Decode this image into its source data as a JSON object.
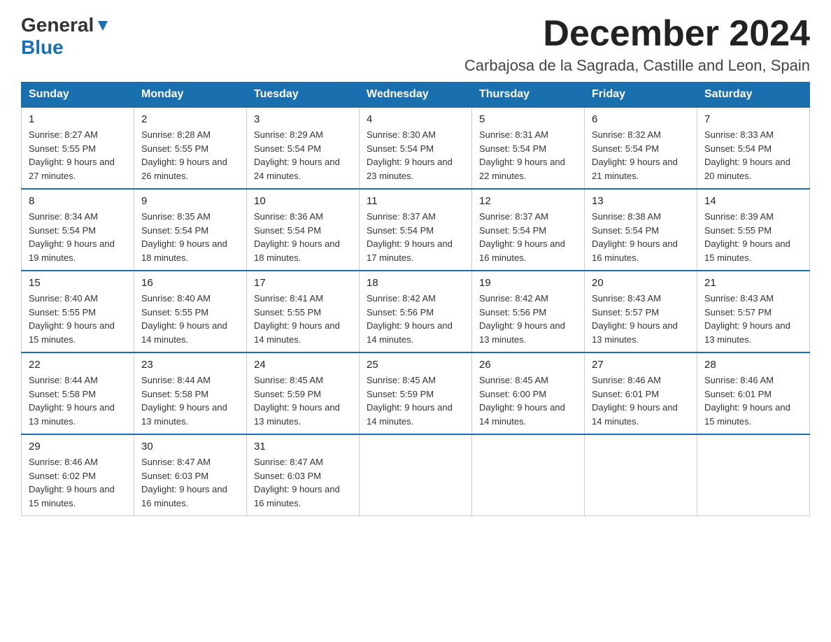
{
  "logo": {
    "general": "General",
    "blue": "Blue"
  },
  "title": "December 2024",
  "subtitle": "Carbajosa de la Sagrada, Castille and Leon, Spain",
  "days_of_week": [
    "Sunday",
    "Monday",
    "Tuesday",
    "Wednesday",
    "Thursday",
    "Friday",
    "Saturday"
  ],
  "weeks": [
    [
      {
        "day": "1",
        "sunrise": "Sunrise: 8:27 AM",
        "sunset": "Sunset: 5:55 PM",
        "daylight": "Daylight: 9 hours and 27 minutes."
      },
      {
        "day": "2",
        "sunrise": "Sunrise: 8:28 AM",
        "sunset": "Sunset: 5:55 PM",
        "daylight": "Daylight: 9 hours and 26 minutes."
      },
      {
        "day": "3",
        "sunrise": "Sunrise: 8:29 AM",
        "sunset": "Sunset: 5:54 PM",
        "daylight": "Daylight: 9 hours and 24 minutes."
      },
      {
        "day": "4",
        "sunrise": "Sunrise: 8:30 AM",
        "sunset": "Sunset: 5:54 PM",
        "daylight": "Daylight: 9 hours and 23 minutes."
      },
      {
        "day": "5",
        "sunrise": "Sunrise: 8:31 AM",
        "sunset": "Sunset: 5:54 PM",
        "daylight": "Daylight: 9 hours and 22 minutes."
      },
      {
        "day": "6",
        "sunrise": "Sunrise: 8:32 AM",
        "sunset": "Sunset: 5:54 PM",
        "daylight": "Daylight: 9 hours and 21 minutes."
      },
      {
        "day": "7",
        "sunrise": "Sunrise: 8:33 AM",
        "sunset": "Sunset: 5:54 PM",
        "daylight": "Daylight: 9 hours and 20 minutes."
      }
    ],
    [
      {
        "day": "8",
        "sunrise": "Sunrise: 8:34 AM",
        "sunset": "Sunset: 5:54 PM",
        "daylight": "Daylight: 9 hours and 19 minutes."
      },
      {
        "day": "9",
        "sunrise": "Sunrise: 8:35 AM",
        "sunset": "Sunset: 5:54 PM",
        "daylight": "Daylight: 9 hours and 18 minutes."
      },
      {
        "day": "10",
        "sunrise": "Sunrise: 8:36 AM",
        "sunset": "Sunset: 5:54 PM",
        "daylight": "Daylight: 9 hours and 18 minutes."
      },
      {
        "day": "11",
        "sunrise": "Sunrise: 8:37 AM",
        "sunset": "Sunset: 5:54 PM",
        "daylight": "Daylight: 9 hours and 17 minutes."
      },
      {
        "day": "12",
        "sunrise": "Sunrise: 8:37 AM",
        "sunset": "Sunset: 5:54 PM",
        "daylight": "Daylight: 9 hours and 16 minutes."
      },
      {
        "day": "13",
        "sunrise": "Sunrise: 8:38 AM",
        "sunset": "Sunset: 5:54 PM",
        "daylight": "Daylight: 9 hours and 16 minutes."
      },
      {
        "day": "14",
        "sunrise": "Sunrise: 8:39 AM",
        "sunset": "Sunset: 5:55 PM",
        "daylight": "Daylight: 9 hours and 15 minutes."
      }
    ],
    [
      {
        "day": "15",
        "sunrise": "Sunrise: 8:40 AM",
        "sunset": "Sunset: 5:55 PM",
        "daylight": "Daylight: 9 hours and 15 minutes."
      },
      {
        "day": "16",
        "sunrise": "Sunrise: 8:40 AM",
        "sunset": "Sunset: 5:55 PM",
        "daylight": "Daylight: 9 hours and 14 minutes."
      },
      {
        "day": "17",
        "sunrise": "Sunrise: 8:41 AM",
        "sunset": "Sunset: 5:55 PM",
        "daylight": "Daylight: 9 hours and 14 minutes."
      },
      {
        "day": "18",
        "sunrise": "Sunrise: 8:42 AM",
        "sunset": "Sunset: 5:56 PM",
        "daylight": "Daylight: 9 hours and 14 minutes."
      },
      {
        "day": "19",
        "sunrise": "Sunrise: 8:42 AM",
        "sunset": "Sunset: 5:56 PM",
        "daylight": "Daylight: 9 hours and 13 minutes."
      },
      {
        "day": "20",
        "sunrise": "Sunrise: 8:43 AM",
        "sunset": "Sunset: 5:57 PM",
        "daylight": "Daylight: 9 hours and 13 minutes."
      },
      {
        "day": "21",
        "sunrise": "Sunrise: 8:43 AM",
        "sunset": "Sunset: 5:57 PM",
        "daylight": "Daylight: 9 hours and 13 minutes."
      }
    ],
    [
      {
        "day": "22",
        "sunrise": "Sunrise: 8:44 AM",
        "sunset": "Sunset: 5:58 PM",
        "daylight": "Daylight: 9 hours and 13 minutes."
      },
      {
        "day": "23",
        "sunrise": "Sunrise: 8:44 AM",
        "sunset": "Sunset: 5:58 PM",
        "daylight": "Daylight: 9 hours and 13 minutes."
      },
      {
        "day": "24",
        "sunrise": "Sunrise: 8:45 AM",
        "sunset": "Sunset: 5:59 PM",
        "daylight": "Daylight: 9 hours and 13 minutes."
      },
      {
        "day": "25",
        "sunrise": "Sunrise: 8:45 AM",
        "sunset": "Sunset: 5:59 PM",
        "daylight": "Daylight: 9 hours and 14 minutes."
      },
      {
        "day": "26",
        "sunrise": "Sunrise: 8:45 AM",
        "sunset": "Sunset: 6:00 PM",
        "daylight": "Daylight: 9 hours and 14 minutes."
      },
      {
        "day": "27",
        "sunrise": "Sunrise: 8:46 AM",
        "sunset": "Sunset: 6:01 PM",
        "daylight": "Daylight: 9 hours and 14 minutes."
      },
      {
        "day": "28",
        "sunrise": "Sunrise: 8:46 AM",
        "sunset": "Sunset: 6:01 PM",
        "daylight": "Daylight: 9 hours and 15 minutes."
      }
    ],
    [
      {
        "day": "29",
        "sunrise": "Sunrise: 8:46 AM",
        "sunset": "Sunset: 6:02 PM",
        "daylight": "Daylight: 9 hours and 15 minutes."
      },
      {
        "day": "30",
        "sunrise": "Sunrise: 8:47 AM",
        "sunset": "Sunset: 6:03 PM",
        "daylight": "Daylight: 9 hours and 16 minutes."
      },
      {
        "day": "31",
        "sunrise": "Sunrise: 8:47 AM",
        "sunset": "Sunset: 6:03 PM",
        "daylight": "Daylight: 9 hours and 16 minutes."
      },
      null,
      null,
      null,
      null
    ]
  ]
}
